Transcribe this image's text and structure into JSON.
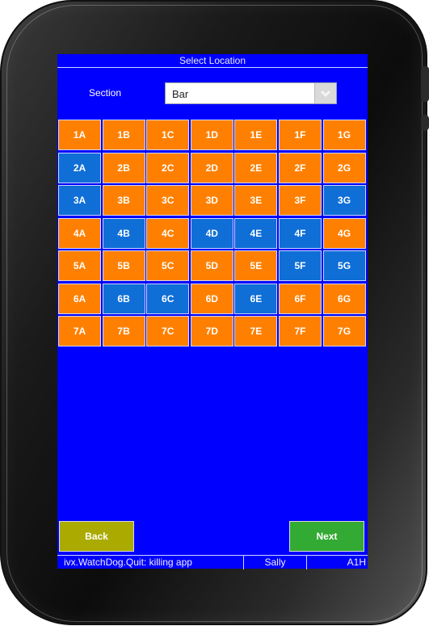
{
  "title": "Select Location",
  "section": {
    "label": "Section",
    "selected": "Bar"
  },
  "tables": [
    [
      {
        "label": "1A",
        "status": "orange"
      },
      {
        "label": "1B",
        "status": "orange"
      },
      {
        "label": "1C",
        "status": "orange"
      },
      {
        "label": "1D",
        "status": "orange"
      },
      {
        "label": "1E",
        "status": "orange"
      },
      {
        "label": "1F",
        "status": "orange"
      },
      {
        "label": "1G",
        "status": "orange"
      }
    ],
    [
      {
        "label": "2A",
        "status": "blue"
      },
      {
        "label": "2B",
        "status": "orange"
      },
      {
        "label": "2C",
        "status": "orange"
      },
      {
        "label": "2D",
        "status": "orange"
      },
      {
        "label": "2E",
        "status": "orange"
      },
      {
        "label": "2F",
        "status": "orange"
      },
      {
        "label": "2G",
        "status": "orange"
      }
    ],
    [
      {
        "label": "3A",
        "status": "blue"
      },
      {
        "label": "3B",
        "status": "orange"
      },
      {
        "label": "3C",
        "status": "orange"
      },
      {
        "label": "3D",
        "status": "orange"
      },
      {
        "label": "3E",
        "status": "orange"
      },
      {
        "label": "3F",
        "status": "orange"
      },
      {
        "label": "3G",
        "status": "blue"
      }
    ],
    [
      {
        "label": "4A",
        "status": "orange"
      },
      {
        "label": "4B",
        "status": "blue"
      },
      {
        "label": "4C",
        "status": "orange"
      },
      {
        "label": "4D",
        "status": "blue"
      },
      {
        "label": "4E",
        "status": "blue"
      },
      {
        "label": "4F",
        "status": "blue"
      },
      {
        "label": "4G",
        "status": "orange"
      }
    ],
    [
      {
        "label": "5A",
        "status": "orange"
      },
      {
        "label": "5B",
        "status": "orange"
      },
      {
        "label": "5C",
        "status": "orange"
      },
      {
        "label": "5D",
        "status": "orange"
      },
      {
        "label": "5E",
        "status": "orange"
      },
      {
        "label": "5F",
        "status": "blue"
      },
      {
        "label": "5G",
        "status": "blue"
      }
    ],
    [
      {
        "label": "6A",
        "status": "orange"
      },
      {
        "label": "6B",
        "status": "blue"
      },
      {
        "label": "6C",
        "status": "blue"
      },
      {
        "label": "6D",
        "status": "orange"
      },
      {
        "label": "6E",
        "status": "blue"
      },
      {
        "label": "6F",
        "status": "orange"
      },
      {
        "label": "6G",
        "status": "orange"
      }
    ],
    [
      {
        "label": "7A",
        "status": "orange"
      },
      {
        "label": "7B",
        "status": "orange"
      },
      {
        "label": "7C",
        "status": "orange"
      },
      {
        "label": "7D",
        "status": "orange"
      },
      {
        "label": "7E",
        "status": "orange"
      },
      {
        "label": "7F",
        "status": "orange"
      },
      {
        "label": "7G",
        "status": "orange"
      }
    ]
  ],
  "buttons": {
    "back": "Back",
    "next": "Next"
  },
  "status": {
    "message": "ivx.WatchDog.Quit: killing app",
    "user": "Sally",
    "code": "A1H"
  },
  "colors": {
    "background": "#0000ff",
    "orange": "#ff8000",
    "blue": "#0f6fd6",
    "back_button": "#aaaa00",
    "next_button": "#33aa33"
  }
}
